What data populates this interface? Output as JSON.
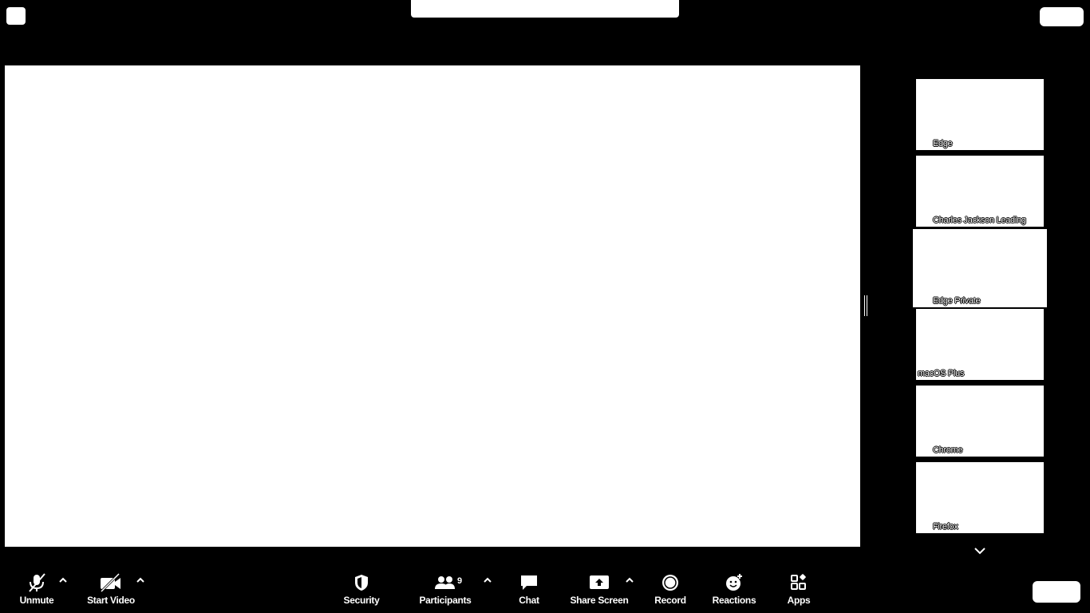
{
  "participants_count": "9",
  "gallery": {
    "tiles": [
      {
        "name": "Edge"
      },
      {
        "name": "Charles Jackson Leading"
      },
      {
        "name": "Edge Private"
      },
      {
        "name": "macOS Plus"
      },
      {
        "name": "Chrome"
      },
      {
        "name": "Firefox"
      }
    ]
  },
  "toolbar": {
    "unmute": "Unmute",
    "start_video": "Start Video",
    "security": "Security",
    "participants": "Participants",
    "chat": "Chat",
    "share_screen": "Share Screen",
    "record": "Record",
    "reactions": "Reactions",
    "apps": "Apps"
  }
}
